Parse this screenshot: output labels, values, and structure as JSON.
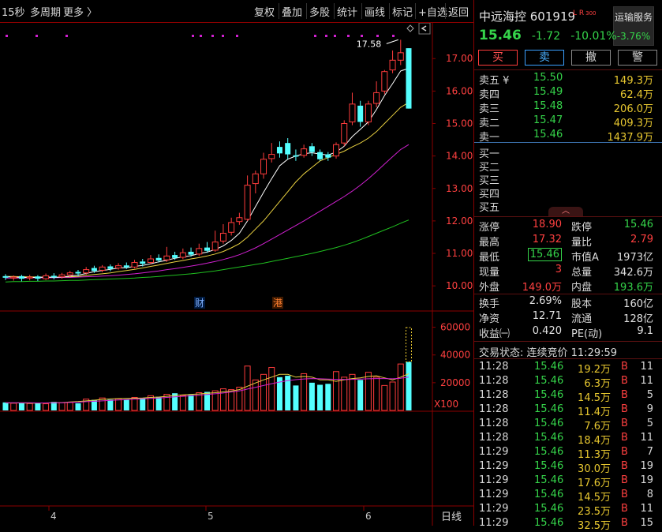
{
  "toolbar": {
    "left_items": [
      "15秒",
      "多周期",
      "更多 〉"
    ],
    "right_items": [
      "复权",
      "叠加",
      "多股",
      "统计",
      "画线",
      "标记",
      "+自选",
      "返回"
    ]
  },
  "chart_data": {
    "type": "candlestick",
    "y_axis_labels": [
      "17.00",
      "16.00",
      "15.00",
      "14.00",
      "13.00",
      "12.00",
      "11.00",
      "10.00"
    ],
    "y_ticks": [
      17,
      16,
      15,
      14,
      13,
      12,
      11,
      10
    ],
    "ylim": [
      9.25,
      18.1
    ],
    "high_annotation": "17.58",
    "x_labels": [
      "4",
      "5",
      "6"
    ],
    "x_period": "日线",
    "event_markers": [
      "财",
      "港"
    ],
    "candles": [
      {
        "o": 10.3,
        "c": 10.25,
        "h": 10.36,
        "l": 10.18
      },
      {
        "o": 10.24,
        "c": 10.27,
        "h": 10.32,
        "l": 10.16
      },
      {
        "o": 10.3,
        "c": 10.22,
        "h": 10.34,
        "l": 10.14
      },
      {
        "o": 10.24,
        "c": 10.27,
        "h": 10.34,
        "l": 10.17
      },
      {
        "o": 10.29,
        "c": 10.22,
        "h": 10.33,
        "l": 10.15
      },
      {
        "o": 10.22,
        "c": 10.31,
        "h": 10.38,
        "l": 10.18
      },
      {
        "o": 10.31,
        "c": 10.26,
        "h": 10.39,
        "l": 10.2
      },
      {
        "o": 10.28,
        "c": 10.34,
        "h": 10.4,
        "l": 10.22
      },
      {
        "o": 10.34,
        "c": 10.4,
        "h": 10.46,
        "l": 10.28
      },
      {
        "o": 10.43,
        "c": 10.38,
        "h": 10.49,
        "l": 10.3
      },
      {
        "o": 10.4,
        "c": 10.5,
        "h": 10.58,
        "l": 10.34
      },
      {
        "o": 10.55,
        "c": 10.46,
        "h": 10.62,
        "l": 10.4
      },
      {
        "o": 10.48,
        "c": 10.58,
        "h": 10.64,
        "l": 10.42
      },
      {
        "o": 10.6,
        "c": 10.52,
        "h": 10.66,
        "l": 10.45
      },
      {
        "o": 10.55,
        "c": 10.62,
        "h": 10.7,
        "l": 10.5
      },
      {
        "o": 10.63,
        "c": 10.57,
        "h": 10.72,
        "l": 10.52
      },
      {
        "o": 10.58,
        "c": 10.72,
        "h": 10.8,
        "l": 10.54
      },
      {
        "o": 10.75,
        "c": 10.68,
        "h": 10.83,
        "l": 10.6
      },
      {
        "o": 10.72,
        "c": 10.83,
        "h": 10.95,
        "l": 10.66
      },
      {
        "o": 10.86,
        "c": 10.78,
        "h": 10.97,
        "l": 10.72
      },
      {
        "o": 10.8,
        "c": 10.92,
        "h": 11.2,
        "l": 10.74
      },
      {
        "o": 10.95,
        "c": 10.86,
        "h": 11.05,
        "l": 10.8
      },
      {
        "o": 10.88,
        "c": 11.02,
        "h": 11.15,
        "l": 10.82
      },
      {
        "o": 11.05,
        "c": 10.96,
        "h": 11.18,
        "l": 10.9
      },
      {
        "o": 10.98,
        "c": 11.15,
        "h": 11.3,
        "l": 10.92
      },
      {
        "o": 11.18,
        "c": 11.08,
        "h": 11.35,
        "l": 11.02
      },
      {
        "o": 11.1,
        "c": 11.35,
        "h": 11.7,
        "l": 11.05
      },
      {
        "o": 11.38,
        "c": 11.62,
        "h": 11.9,
        "l": 11.3
      },
      {
        "o": 11.65,
        "c": 11.95,
        "h": 12.1,
        "l": 11.55
      },
      {
        "o": 11.98,
        "c": 12.1,
        "h": 12.25,
        "l": 11.88
      },
      {
        "o": 12.05,
        "c": 13.1,
        "h": 13.4,
        "l": 12.0
      },
      {
        "o": 13.15,
        "c": 13.45,
        "h": 13.55,
        "l": 12.85
      },
      {
        "o": 13.45,
        "c": 13.9,
        "h": 14.1,
        "l": 13.3
      },
      {
        "o": 13.92,
        "c": 14.05,
        "h": 14.4,
        "l": 13.8
      },
      {
        "o": 14.28,
        "c": 14.08,
        "h": 14.45,
        "l": 13.95
      },
      {
        "o": 14.4,
        "c": 14.05,
        "h": 14.55,
        "l": 13.9
      },
      {
        "o": 14.02,
        "c": 13.98,
        "h": 14.2,
        "l": 13.85
      },
      {
        "o": 14.02,
        "c": 14.22,
        "h": 14.35,
        "l": 13.95
      },
      {
        "o": 14.3,
        "c": 14.12,
        "h": 14.4,
        "l": 14.0
      },
      {
        "o": 14.12,
        "c": 13.9,
        "h": 14.2,
        "l": 13.85
      },
      {
        "o": 14.05,
        "c": 13.95,
        "h": 14.12,
        "l": 13.85
      },
      {
        "o": 14.0,
        "c": 14.35,
        "h": 14.42,
        "l": 13.92
      },
      {
        "o": 14.4,
        "c": 15.0,
        "h": 15.1,
        "l": 14.3
      },
      {
        "o": 15.05,
        "c": 15.6,
        "h": 15.95,
        "l": 14.95
      },
      {
        "o": 15.55,
        "c": 15.05,
        "h": 15.7,
        "l": 14.9
      },
      {
        "o": 15.05,
        "c": 15.6,
        "h": 15.7,
        "l": 14.95
      },
      {
        "o": 15.62,
        "c": 15.95,
        "h": 16.3,
        "l": 15.5
      },
      {
        "o": 16.0,
        "c": 16.6,
        "h": 16.65,
        "l": 15.9
      },
      {
        "o": 16.65,
        "c": 16.95,
        "h": 17.25,
        "l": 16.55
      },
      {
        "o": 16.95,
        "c": 17.18,
        "h": 17.58,
        "l": 16.8
      },
      {
        "o": 17.32,
        "c": 15.46,
        "h": 17.32,
        "l": 15.46
      }
    ],
    "ma5": [
      10.28,
      10.27,
      10.26,
      10.26,
      10.26,
      10.27,
      10.26,
      10.27,
      10.3,
      10.33,
      10.38,
      10.44,
      10.47,
      10.51,
      10.55,
      10.56,
      10.6,
      10.63,
      10.68,
      10.74,
      10.79,
      10.85,
      10.89,
      10.93,
      10.99,
      11.04,
      11.12,
      11.23,
      11.4,
      11.62,
      12.0,
      12.44,
      12.88,
      13.3,
      13.7,
      13.9,
      14.0,
      14.07,
      14.1,
      14.06,
      14.03,
      14.12,
      14.3,
      14.6,
      14.82,
      15.05,
      15.43,
      15.86,
      16.23,
      16.62,
      16.7
    ],
    "ma10": [
      10.29,
      10.29,
      10.28,
      10.28,
      10.27,
      10.27,
      10.27,
      10.27,
      10.28,
      10.29,
      10.32,
      10.35,
      10.37,
      10.4,
      10.44,
      10.47,
      10.51,
      10.55,
      10.6,
      10.64,
      10.69,
      10.74,
      10.78,
      10.83,
      10.87,
      10.92,
      10.98,
      11.06,
      11.17,
      11.3,
      11.5,
      11.75,
      12.0,
      12.3,
      12.6,
      12.9,
      13.2,
      13.45,
      13.65,
      13.85,
      13.95,
      14.05,
      14.15,
      14.28,
      14.4,
      14.55,
      14.75,
      15.0,
      15.25,
      15.5,
      15.65
    ],
    "ma20": [
      10.24,
      10.24,
      10.24,
      10.25,
      10.25,
      10.25,
      10.25,
      10.26,
      10.26,
      10.27,
      10.28,
      10.29,
      10.3,
      10.31,
      10.33,
      10.35,
      10.37,
      10.4,
      10.43,
      10.46,
      10.5,
      10.53,
      10.57,
      10.61,
      10.65,
      10.7,
      10.75,
      10.81,
      10.88,
      10.96,
      11.06,
      11.17,
      11.3,
      11.44,
      11.58,
      11.72,
      11.86,
      12.0,
      12.15,
      12.3,
      12.45,
      12.6,
      12.75,
      12.92,
      13.1,
      13.3,
      13.52,
      13.75,
      13.98,
      14.2,
      14.35
    ],
    "ma60": [
      10.12,
      10.13,
      10.13,
      10.14,
      10.14,
      10.15,
      10.15,
      10.16,
      10.17,
      10.17,
      10.18,
      10.19,
      10.2,
      10.21,
      10.22,
      10.23,
      10.24,
      10.26,
      10.27,
      10.29,
      10.31,
      10.33,
      10.35,
      10.37,
      10.4,
      10.43,
      10.46,
      10.5,
      10.54,
      10.58,
      10.62,
      10.66,
      10.7,
      10.75,
      10.8,
      10.85,
      10.9,
      10.95,
      11.0,
      11.06,
      11.12,
      11.18,
      11.25,
      11.33,
      11.42,
      11.52,
      11.62,
      11.72,
      11.82,
      11.93,
      12.03
    ],
    "volume": {
      "unit_label": "X100",
      "y_axis_labels": [
        "60000",
        "40000",
        "20000"
      ],
      "y_ticks": [
        60000,
        40000,
        20000
      ],
      "ylim": [
        0,
        70000
      ],
      "values": [
        5800,
        5200,
        5600,
        5000,
        5400,
        4800,
        6200,
        5600,
        5800,
        5200,
        8200,
        7600,
        9000,
        7800,
        8400,
        8000,
        9400,
        8800,
        10600,
        9800,
        11600,
        12400,
        10800,
        11200,
        12800,
        13400,
        14200,
        15600,
        15000,
        16800,
        32000,
        22000,
        26000,
        31000,
        24000,
        25000,
        18000,
        26500,
        20000,
        18500,
        19200,
        28000,
        24000,
        26000,
        22000,
        27500,
        24000,
        18000,
        20500,
        33500,
        35000
      ],
      "ma_a": [
        5400,
        5400,
        5400,
        5300,
        5300,
        5400,
        5500,
        5700,
        6100,
        6400,
        6900,
        7400,
        7900,
        8300,
        8600,
        8700,
        8800,
        9000,
        9400,
        9700,
        10200,
        10800,
        11200,
        11600,
        11900,
        12400,
        12800,
        13400,
        14000,
        15000,
        17500,
        19800,
        22000,
        24000,
        26000,
        26000,
        24000,
        24500,
        24000,
        22000,
        22000,
        21000,
        22000,
        23000,
        23500,
        24500,
        25000,
        23500,
        22000,
        24000,
        26500
      ],
      "ma_b": [
        5500,
        5500,
        5500,
        5500,
        5400,
        5400,
        5500,
        5600,
        5800,
        6000,
        6300,
        6600,
        6900,
        7200,
        7500,
        7800,
        8100,
        8400,
        8700,
        9000,
        9400,
        9800,
        10200,
        10600,
        11000,
        11500,
        12000,
        12600,
        13300,
        14100,
        15400,
        16700,
        18000,
        19300,
        20500,
        21500,
        22200,
        22700,
        23000,
        22800,
        22600,
        22400,
        22300,
        22400,
        22600,
        22800,
        23000,
        23000,
        22800,
        23200,
        24000
      ]
    }
  },
  "stock": {
    "name_code": "中远海控 601919",
    "flags": "L R",
    "flag_suffix": "300",
    "price": "15.46",
    "change": "-1.72",
    "change_pct": "-10.01%",
    "sector_name": "运输服务",
    "sector_pct": "-3.76%"
  },
  "actions": {
    "buy": "买",
    "sell": "卖",
    "cancel": "撤",
    "alert": "警"
  },
  "orderbook": {
    "asks": [
      {
        "label": "卖五 ¥",
        "price": "15.50",
        "vol": "149.3万"
      },
      {
        "label": "卖四",
        "price": "15.49",
        "vol": "62.4万"
      },
      {
        "label": "卖三",
        "price": "15.48",
        "vol": "206.0万"
      },
      {
        "label": "卖二",
        "price": "15.47",
        "vol": "409.3万"
      },
      {
        "label": "卖一",
        "price": "15.46",
        "vol": "1437.9万"
      }
    ],
    "bids": [
      {
        "label": "买一"
      },
      {
        "label": "买二"
      },
      {
        "label": "买三"
      },
      {
        "label": "买四"
      },
      {
        "label": "买五"
      }
    ],
    "collapse_glyph": "︿"
  },
  "stats": {
    "limit_up_label": "涨停",
    "limit_up": "18.90",
    "limit_down_label": "跌停",
    "limit_down": "15.46",
    "high_label": "最高",
    "high": "17.32",
    "vol_ratio_label": "量比",
    "vol_ratio": "2.79",
    "low_label": "最低",
    "low": "15.46",
    "mktcap_a_label": "市值A",
    "mktcap_a": "1973亿",
    "current_label": "现量",
    "current": "3",
    "total_vol_label": "总量",
    "total_vol": "342.6万",
    "outer_label": "外盘",
    "outer": "149.0万",
    "inner_label": "内盘",
    "inner": "193.6万",
    "turnover_label": "换手",
    "turnover": "2.69%",
    "capital_label": "股本",
    "capital": "160亿",
    "nav_label": "净资",
    "nav": "12.71",
    "float_label": "流通",
    "float": "128亿",
    "eps_label": "收益㈠",
    "eps": "0.420",
    "pe_label": "PE(动)",
    "pe": "9.1"
  },
  "trading_status": "交易状态: 连续竞价 11:29:59",
  "trades": [
    {
      "time": "11:28",
      "price": "15.46",
      "vol": "19.2万",
      "side": "B",
      "n": "11"
    },
    {
      "time": "11:28",
      "price": "15.46",
      "vol": "6.3万",
      "side": "B",
      "n": "11"
    },
    {
      "time": "11:28",
      "price": "15.46",
      "vol": "14.5万",
      "side": "B",
      "n": "5"
    },
    {
      "time": "11:28",
      "price": "15.46",
      "vol": "11.4万",
      "side": "B",
      "n": "9"
    },
    {
      "time": "11:28",
      "price": "15.46",
      "vol": "7.6万",
      "side": "B",
      "n": "5"
    },
    {
      "time": "11:28",
      "price": "15.46",
      "vol": "18.4万",
      "side": "B",
      "n": "11"
    },
    {
      "time": "11:29",
      "price": "15.46",
      "vol": "11.3万",
      "side": "B",
      "n": "7"
    },
    {
      "time": "11:29",
      "price": "15.46",
      "vol": "30.0万",
      "side": "B",
      "n": "19"
    },
    {
      "time": "11:29",
      "price": "15.46",
      "vol": "17.6万",
      "side": "B",
      "n": "19"
    },
    {
      "time": "11:29",
      "price": "15.46",
      "vol": "14.5万",
      "side": "B",
      "n": "8"
    },
    {
      "time": "11:29",
      "price": "15.46",
      "vol": "23.5万",
      "side": "B",
      "n": "11"
    },
    {
      "time": "11:29",
      "price": "15.46",
      "vol": "32.5万",
      "side": "B",
      "n": "15"
    }
  ],
  "colors": {
    "up": "#ff3c3c",
    "down": "#54ffff",
    "ma5": "#ffffff",
    "ma10": "#e8d040",
    "ma20": "#d020d0",
    "ma60": "#20c020",
    "grid": "#8b0000",
    "text_green": "#35d44a",
    "text_red": "#ff4040",
    "text_yellow": "#e8c830"
  }
}
